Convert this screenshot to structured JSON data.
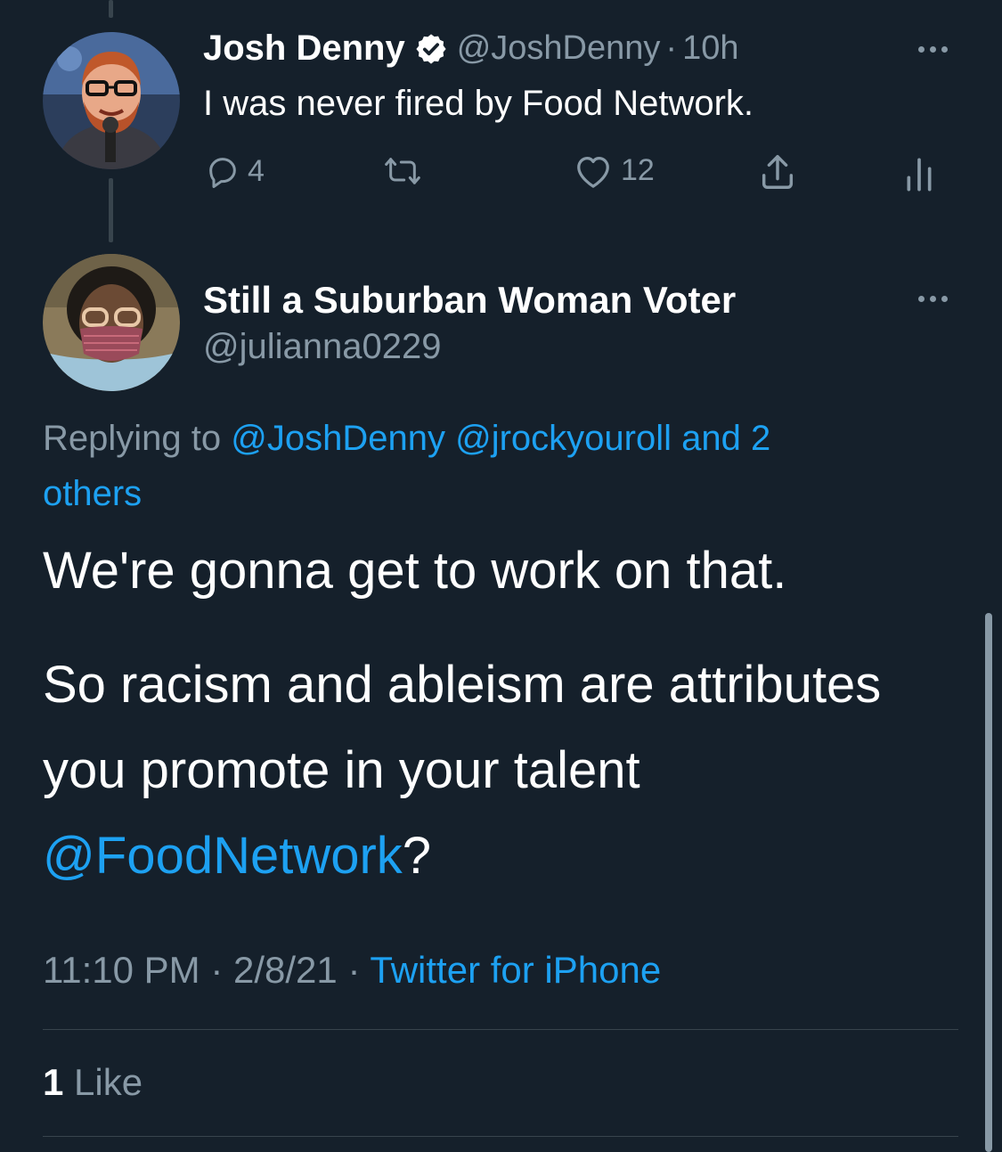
{
  "parent_tweet": {
    "display_name": "Josh Denny",
    "handle": "@JoshDenny",
    "time": "10h",
    "separator": "·",
    "text": "I was never fired by Food Network.",
    "reply_count": "4",
    "like_count": "12"
  },
  "reply_tweet": {
    "display_name": "Still a Suburban Woman Voter",
    "handle": "@julianna0229",
    "replying_prefix": "Replying to",
    "replying_to_1": "@JoshDenny",
    "replying_to_2": "@jrockyouroll",
    "replying_and_others_1": "and 2",
    "replying_and_others_2": "others",
    "paragraph_1": "We're gonna get to work on that.",
    "paragraph_2_line_1": "So racism and ableism are attributes",
    "paragraph_2_line_2": "you promote in your talent",
    "mention": "@FoodNetwork",
    "question_mark": "?",
    "time": "11:10 PM",
    "date": "2/8/21",
    "source": "Twitter for iPhone",
    "separator": "·",
    "likes_count": "1",
    "likes_label": "Like"
  },
  "icons": [
    "verified-badge-icon",
    "more-icon",
    "reply-icon",
    "retweet-icon",
    "like-icon",
    "share-icon",
    "analytics-icon"
  ],
  "colors": {
    "background": "#15202b",
    "link": "#1da1f2",
    "muted": "#8899a6",
    "divider": "#38444d"
  }
}
